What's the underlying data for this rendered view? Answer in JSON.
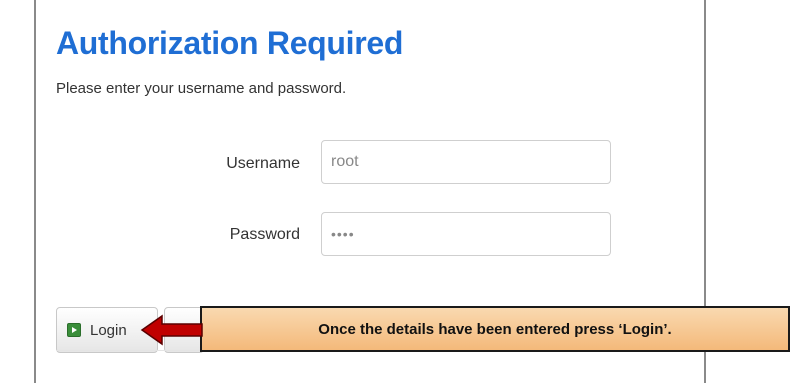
{
  "header": {
    "title": "Authorization Required",
    "subtitle": "Please enter your username and password."
  },
  "form": {
    "username_label": "Username",
    "username_value": "root",
    "password_label": "Password",
    "password_value": "••••"
  },
  "buttons": {
    "login_label": "Login",
    "login_icon": "login-icon",
    "reset_icon": "reset-icon"
  },
  "annotation": {
    "callout_text": "Once the details have been entered press ‘Login’.",
    "callout_color": "#f4b97a",
    "arrow_color": "#c00000"
  }
}
